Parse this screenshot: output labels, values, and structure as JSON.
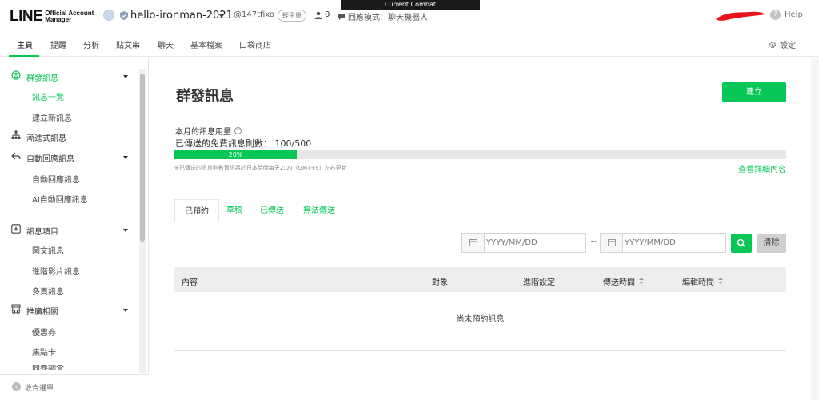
{
  "header": {
    "logo_main": "LINE",
    "logo_sub_1": "Official Account",
    "logo_sub_2": "Manager",
    "account_name": "hello-ironman-2021",
    "account_id": "@147tfixo",
    "plan_badge": "輕用量",
    "friends_count": "0",
    "reply_mode": "回應模式：聊天機器人",
    "overlay_label": "Current Combat",
    "help_label": "Help",
    "accent_color": "#06c755"
  },
  "nav": {
    "tabs": [
      "主頁",
      "提醒",
      "分析",
      "貼文串",
      "聊天",
      "基本檔案",
      "口袋商店"
    ],
    "settings_label": "設定"
  },
  "sidebar": {
    "group_broadcast": "群發訊息",
    "sub_list": "訊息一覽",
    "sub_create": "建立新訊息",
    "step_message": "漸進式訊息",
    "auto_reply": "自動回應訊息",
    "sub_auto_reply": "自動回應訊息",
    "sub_ai_reply": "AI自動回應訊息",
    "message_items": "訊息項目",
    "sub_rich": "圖文訊息",
    "sub_video": "進階影片訊息",
    "sub_multi": "多頁訊息",
    "promotion": "推廣相關",
    "sub_coupon": "優惠券",
    "sub_card": "集點卡",
    "sub_partial": "問卷調查",
    "collapse_label": "收合選單"
  },
  "main": {
    "title": "群發訊息",
    "create_button": "建立",
    "usage_label": "本月的訊息用量",
    "sent_label": "已傳送的免費訊息則數：",
    "sent_value": "100/500",
    "progress_percent": 20,
    "progress_text": "20%",
    "note": "※已傳送的訊息則數資訊將於日本時間每天2:00（GMT+9）左右更新",
    "detail_link": "查看詳細內容",
    "message_tabs": [
      "已預約",
      "草稿",
      "已傳送",
      "無法傳送"
    ],
    "date_placeholder_start": "YYYY/MM/DD",
    "date_placeholder_end": "YYYY/MM/DD",
    "date_separator": "~",
    "clear_button": "清除",
    "table_headers": [
      "內容",
      "對象",
      "進階設定",
      "傳送時間",
      "編輯時間"
    ],
    "empty_text": "尚未預約訊息"
  }
}
